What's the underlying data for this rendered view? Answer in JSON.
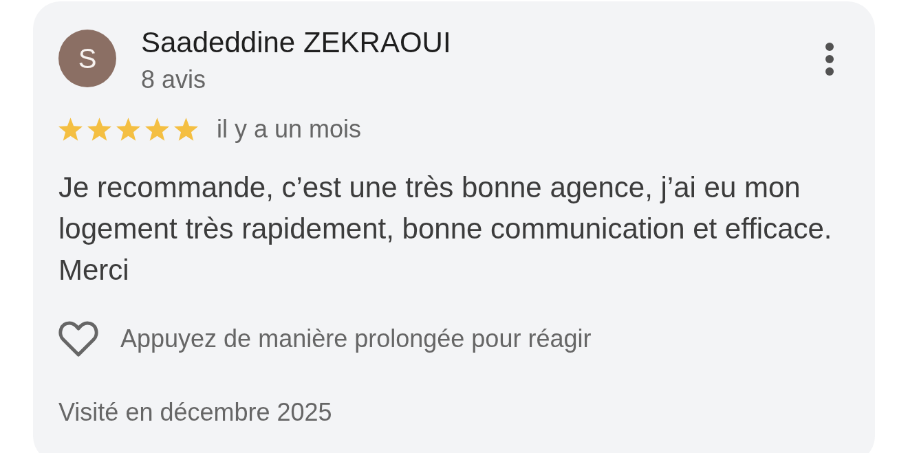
{
  "review": {
    "avatar_letter": "S",
    "author": "Saadeddine ZEKRAOUI",
    "review_count": "8 avis",
    "stars": 5,
    "time": "il y a un mois",
    "text": "Je recommande, c’est une très bonne agence, j’ai eu mon logement très rapidement, bonne communication et efficace. Merci",
    "reaction_hint": "Appuyez de manière prolongée pour réagir",
    "visit": "Visité en décembre 2025"
  }
}
